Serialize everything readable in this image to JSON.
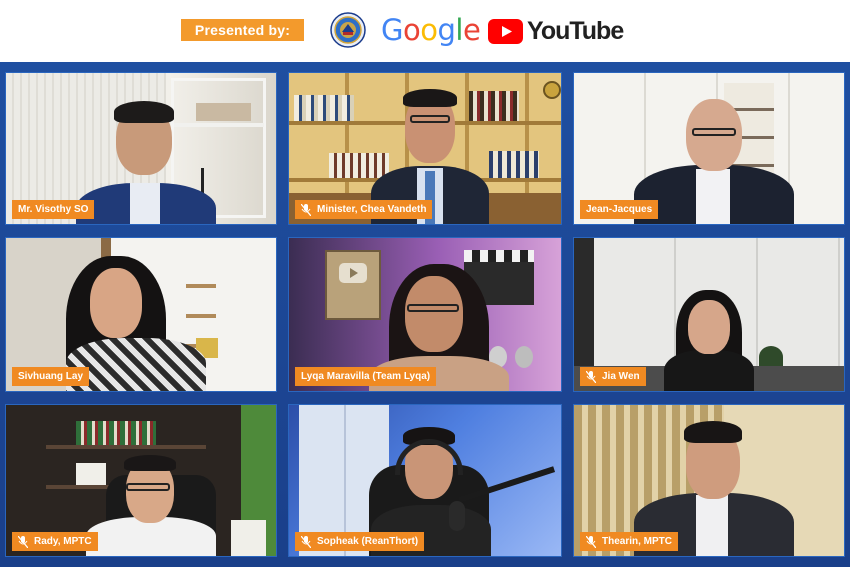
{
  "header": {
    "presented_label": "Presented by:",
    "google_letters": [
      {
        "ch": "G",
        "color": "#4285F4"
      },
      {
        "ch": "o",
        "color": "#EA4335"
      },
      {
        "ch": "o",
        "color": "#FBBC05"
      },
      {
        "ch": "g",
        "color": "#4285F4"
      },
      {
        "ch": "l",
        "color": "#34A853"
      },
      {
        "ch": "e",
        "color": "#EA4335"
      }
    ],
    "youtube_label": "YouTube"
  },
  "participants": [
    {
      "name": "Mr. Visothy SO",
      "mic": false
    },
    {
      "name": "Minister, Chea Vandeth",
      "mic": true
    },
    {
      "name": "Jean-Jacques",
      "mic": false
    },
    {
      "name": "Sivhuang Lay",
      "mic": false
    },
    {
      "name": "Lyqa Maravilla (Team Lyqa)",
      "mic": false
    },
    {
      "name": "Jia Wen",
      "mic": true
    },
    {
      "name": "Rady, MPTC",
      "mic": true
    },
    {
      "name": "Sopheak (ReanThort)",
      "mic": true
    },
    {
      "name": "Thearin, MPTC",
      "mic": true
    }
  ],
  "colors": {
    "accent_orange": "#F08A22",
    "frame_blue": "#1F4FA1",
    "youtube_red": "#FF0000"
  }
}
